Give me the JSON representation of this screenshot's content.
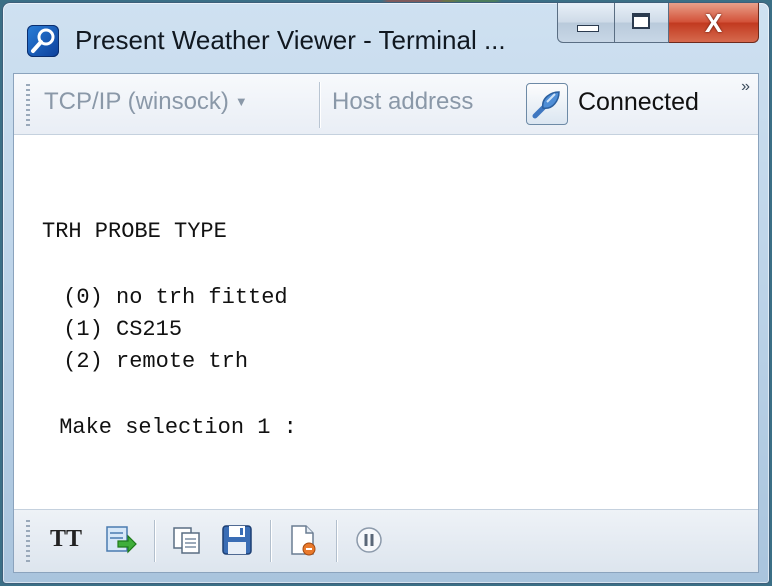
{
  "window": {
    "title": "Present Weather Viewer - Terminal ...",
    "close_glyph": "X"
  },
  "toolbar": {
    "connection_type": "TCP/IP (winsock)",
    "host_address": "Host address",
    "status": "Connected",
    "overflow": "»"
  },
  "terminal": {
    "lines": [
      "TRH PROBE TYPE",
      " (0) no trh fitted",
      " (1) CS215",
      " (2) remote trh",
      " Make selection 1 :"
    ]
  },
  "bottom_toolbar": {
    "font_button": "TT"
  },
  "icons": {
    "app": "magnifier-icon",
    "connect": "cable-plug-icon",
    "send": "send-file-icon",
    "copy": "copy-icon",
    "save": "save-icon",
    "log": "log-file-icon",
    "pause": "pause-icon"
  },
  "colors": {
    "close_red": "#c23a20",
    "window_frame": "#bcd3e8"
  }
}
